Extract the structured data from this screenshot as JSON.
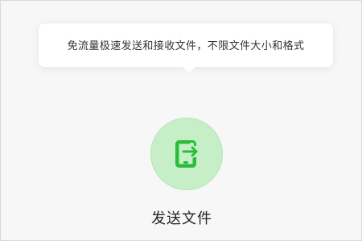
{
  "tooltip": {
    "text": "免流量极速发送和接收文件，不限文件大小和格式"
  },
  "send": {
    "label": "发送文件",
    "icon": "send-file-icon"
  },
  "colors": {
    "accent": "#2bbd3a",
    "button_bg": "#c6efc8",
    "page_bg": "#f7f7f7"
  }
}
